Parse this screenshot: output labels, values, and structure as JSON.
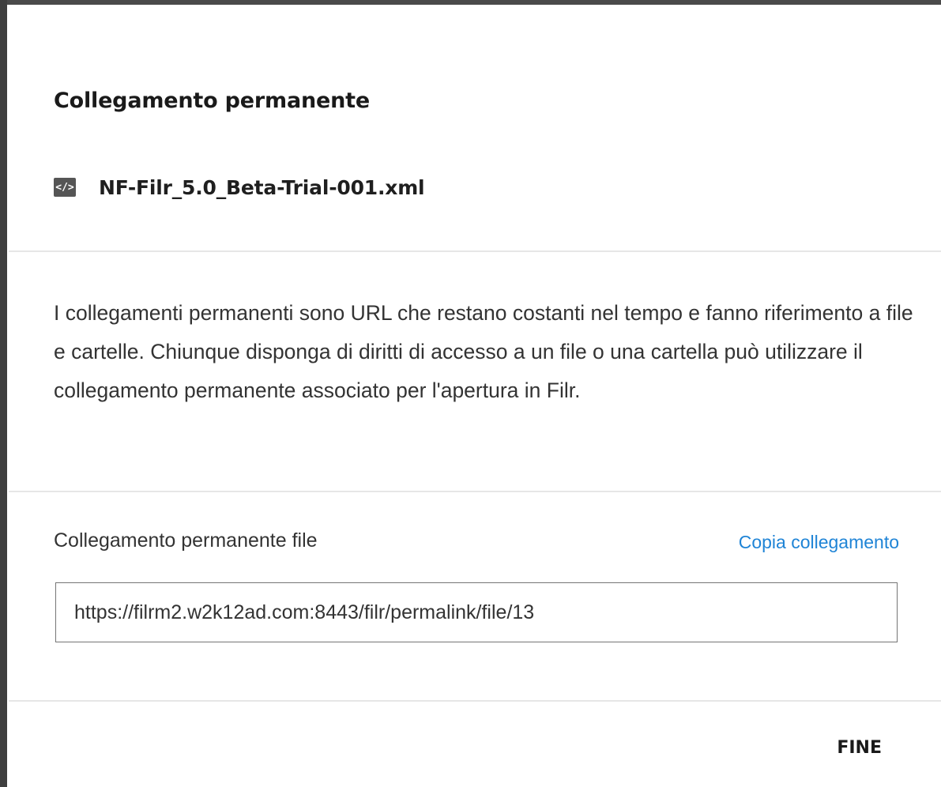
{
  "dialog": {
    "title": "Collegamento permanente",
    "file": {
      "name": "NF-Filr_5.0_Beta-Trial-001.xml",
      "icon": "xml-file-icon",
      "icon_glyph": "</>"
    },
    "description": "I collegamenti permanenti sono URL che restano costanti nel tempo e fanno riferimento a file e cartelle. Chiunque disponga di diritti di accesso a un file o una cartella può utilizzare il collegamento permanente associato per l'apertura in Filr.",
    "permalink": {
      "label": "Collegamento permanente file",
      "copy_label": "Copia collegamento",
      "value": "https://filrm2.w2k12ad.com:8443/filr/permalink/file/13"
    },
    "done_label": "FINE"
  },
  "colors": {
    "link": "#1f84d6",
    "text": "#333333",
    "title": "#1a1a1a",
    "divider": "#e6e6e6",
    "icon_bg": "#555555"
  }
}
